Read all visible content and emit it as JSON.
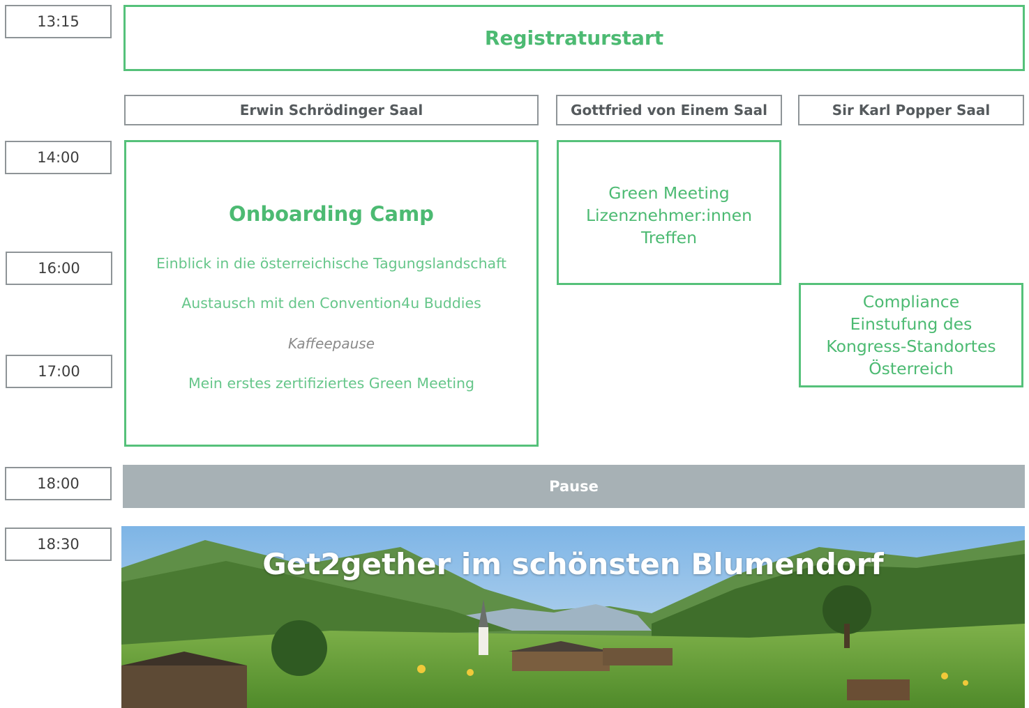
{
  "times": [
    "13:15",
    "14:00",
    "16:00",
    "17:00",
    "18:00",
    "18:30"
  ],
  "registration": "Registraturstart",
  "rooms": [
    "Erwin Schrödinger Saal",
    "Gottfried von Einem Saal",
    "Sir Karl Popper Saal"
  ],
  "onboarding": {
    "title": "Onboarding Camp",
    "items": [
      "Einblick in die österreichische Tagungslandschaft",
      "Austausch mit den Convention4u Buddies",
      "Kaffeepause",
      "Mein erstes zertifiziertes Green Meeting"
    ]
  },
  "green_meeting": [
    "Green Meeting",
    "Lizenznehmer:innen",
    "Treffen"
  ],
  "compliance": [
    "Compliance",
    "Einstufung des",
    "Kongress-Standortes",
    "Österreich"
  ],
  "pause": "Pause",
  "get2gether": {
    "title": "Get2gether im schönsten Blumendorf",
    "image": "alpine-village-photo"
  },
  "colors": {
    "green": "#4cba72",
    "grey_border": "#8e9497",
    "pause_bg": "#a7b1b5"
  }
}
